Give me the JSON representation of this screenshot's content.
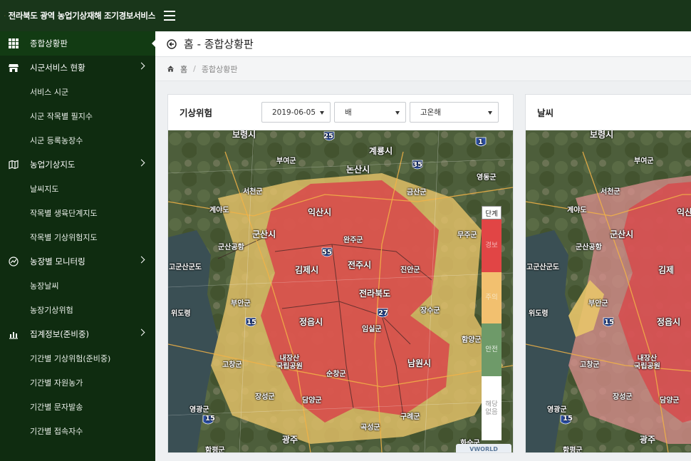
{
  "app": {
    "title": "전라북도 광역 농업기상재해 조기경보서비스"
  },
  "sidebar": {
    "items": [
      {
        "label": "종합상황판",
        "type": "top",
        "icon": "grid-icon",
        "active": true
      },
      {
        "label": "시군서비스 현황",
        "type": "top",
        "icon": "store-icon",
        "chevron": true
      },
      {
        "label": "서비스 시군",
        "type": "sub"
      },
      {
        "label": "시군 작목별 필지수",
        "type": "sub"
      },
      {
        "label": "시군 등록농장수",
        "type": "sub"
      },
      {
        "label": "농업기상지도",
        "type": "top",
        "icon": "map-icon",
        "chevron": true
      },
      {
        "label": "날씨지도",
        "type": "sub"
      },
      {
        "label": "작목별 생육단계지도",
        "type": "sub"
      },
      {
        "label": "작목별 기상위험지도",
        "type": "sub"
      },
      {
        "label": "농장별 모니터링",
        "type": "top",
        "icon": "monitor-icon",
        "chevron": true
      },
      {
        "label": "농장날씨",
        "type": "sub"
      },
      {
        "label": "농장기상위험",
        "type": "sub"
      },
      {
        "label": "집계정보(준비중)",
        "type": "top",
        "icon": "chart-icon",
        "chevron": true
      },
      {
        "label": "기간별 기상위험(준비중)",
        "type": "sub"
      },
      {
        "label": "기간별 자원농가",
        "type": "sub"
      },
      {
        "label": "기간별 문자발송",
        "type": "sub"
      },
      {
        "label": "기간별 접속자수",
        "type": "sub"
      }
    ]
  },
  "page": {
    "title": "홈 - 종합상황판",
    "breadcrumb": {
      "home": "홈",
      "sep": "/",
      "current": "종합상황판"
    }
  },
  "panel_left": {
    "title": "기상위험",
    "date": "2019-06-05",
    "crop": "배",
    "hazard": "고온해",
    "legend": {
      "title": "단계",
      "levels": [
        {
          "label": "경보",
          "color": "#e14545"
        },
        {
          "label": "주의",
          "color": "#f2c06f"
        },
        {
          "label": "안전",
          "color": "#6e9a69"
        },
        {
          "label": "해당 없음",
          "color": "#ffffff"
        }
      ]
    },
    "map_labels": {
      "boryeong": "보령시",
      "gyeryong": "계룡시",
      "buyeo": "부여군",
      "nonsan": "논산시",
      "yeongdong": "영동군",
      "seocheon": "서천군",
      "geumsan": "금산군",
      "gyeyado": "계야도",
      "iksan": "익산시",
      "gunsan": "군산시",
      "wanju": "완주군",
      "muju": "무주군",
      "gunsan_airport": "군산공항",
      "gogunsan": "고군산군도",
      "gimje": "김제시",
      "jeonju": "전주시",
      "jinan": "진안군",
      "wido": "위도령",
      "buan": "부안군",
      "center": "전라북도",
      "jangsu": "장수군",
      "jeongeup": "정읍시",
      "imsil": "임실군",
      "hamyang": "함양군",
      "naejang": "내장산\n국립공원",
      "gochang": "고창군",
      "sunchang": "순창군",
      "namwon": "남원시",
      "jangseong": "장성군",
      "damyang": "담양군",
      "yeonggwang": "영광군",
      "gurye": "구례군",
      "gokseong": "곡성군",
      "gwangju": "광주",
      "hampyeong": "함평군",
      "hwasun": "화순군",
      "r25": "25",
      "r1": "1",
      "r35": "35",
      "r55": "55",
      "r27": "27",
      "r15": "15"
    },
    "map_brand": "VWORLD"
  },
  "panel_right": {
    "title": "날씨",
    "map_labels": {
      "boryeong": "보령시",
      "buyeo": "부여군",
      "seocheon": "서천군",
      "gyeyado": "계야도",
      "iksan": "익산",
      "gunsan": "군산시",
      "gunsan_airport": "군산공항",
      "gogunsan": "고군산군도",
      "gimje": "김제",
      "wido": "위도령",
      "buan": "부안군",
      "jeongeup": "정읍시",
      "gochang": "고창군",
      "naejang": "내장산\n국립공원",
      "jangseong": "장성군",
      "damyang": "담양군",
      "yeonggwang": "영광군",
      "gwangju": "광주",
      "hampyeong": "함평군",
      "r15a": "15",
      "r15b": "15"
    }
  },
  "colors": {
    "topbar": "#19361a",
    "sidebar": "#0f2c10",
    "danger": "#e14545",
    "caution": "#f2c06f",
    "safe": "#6e9a69"
  }
}
